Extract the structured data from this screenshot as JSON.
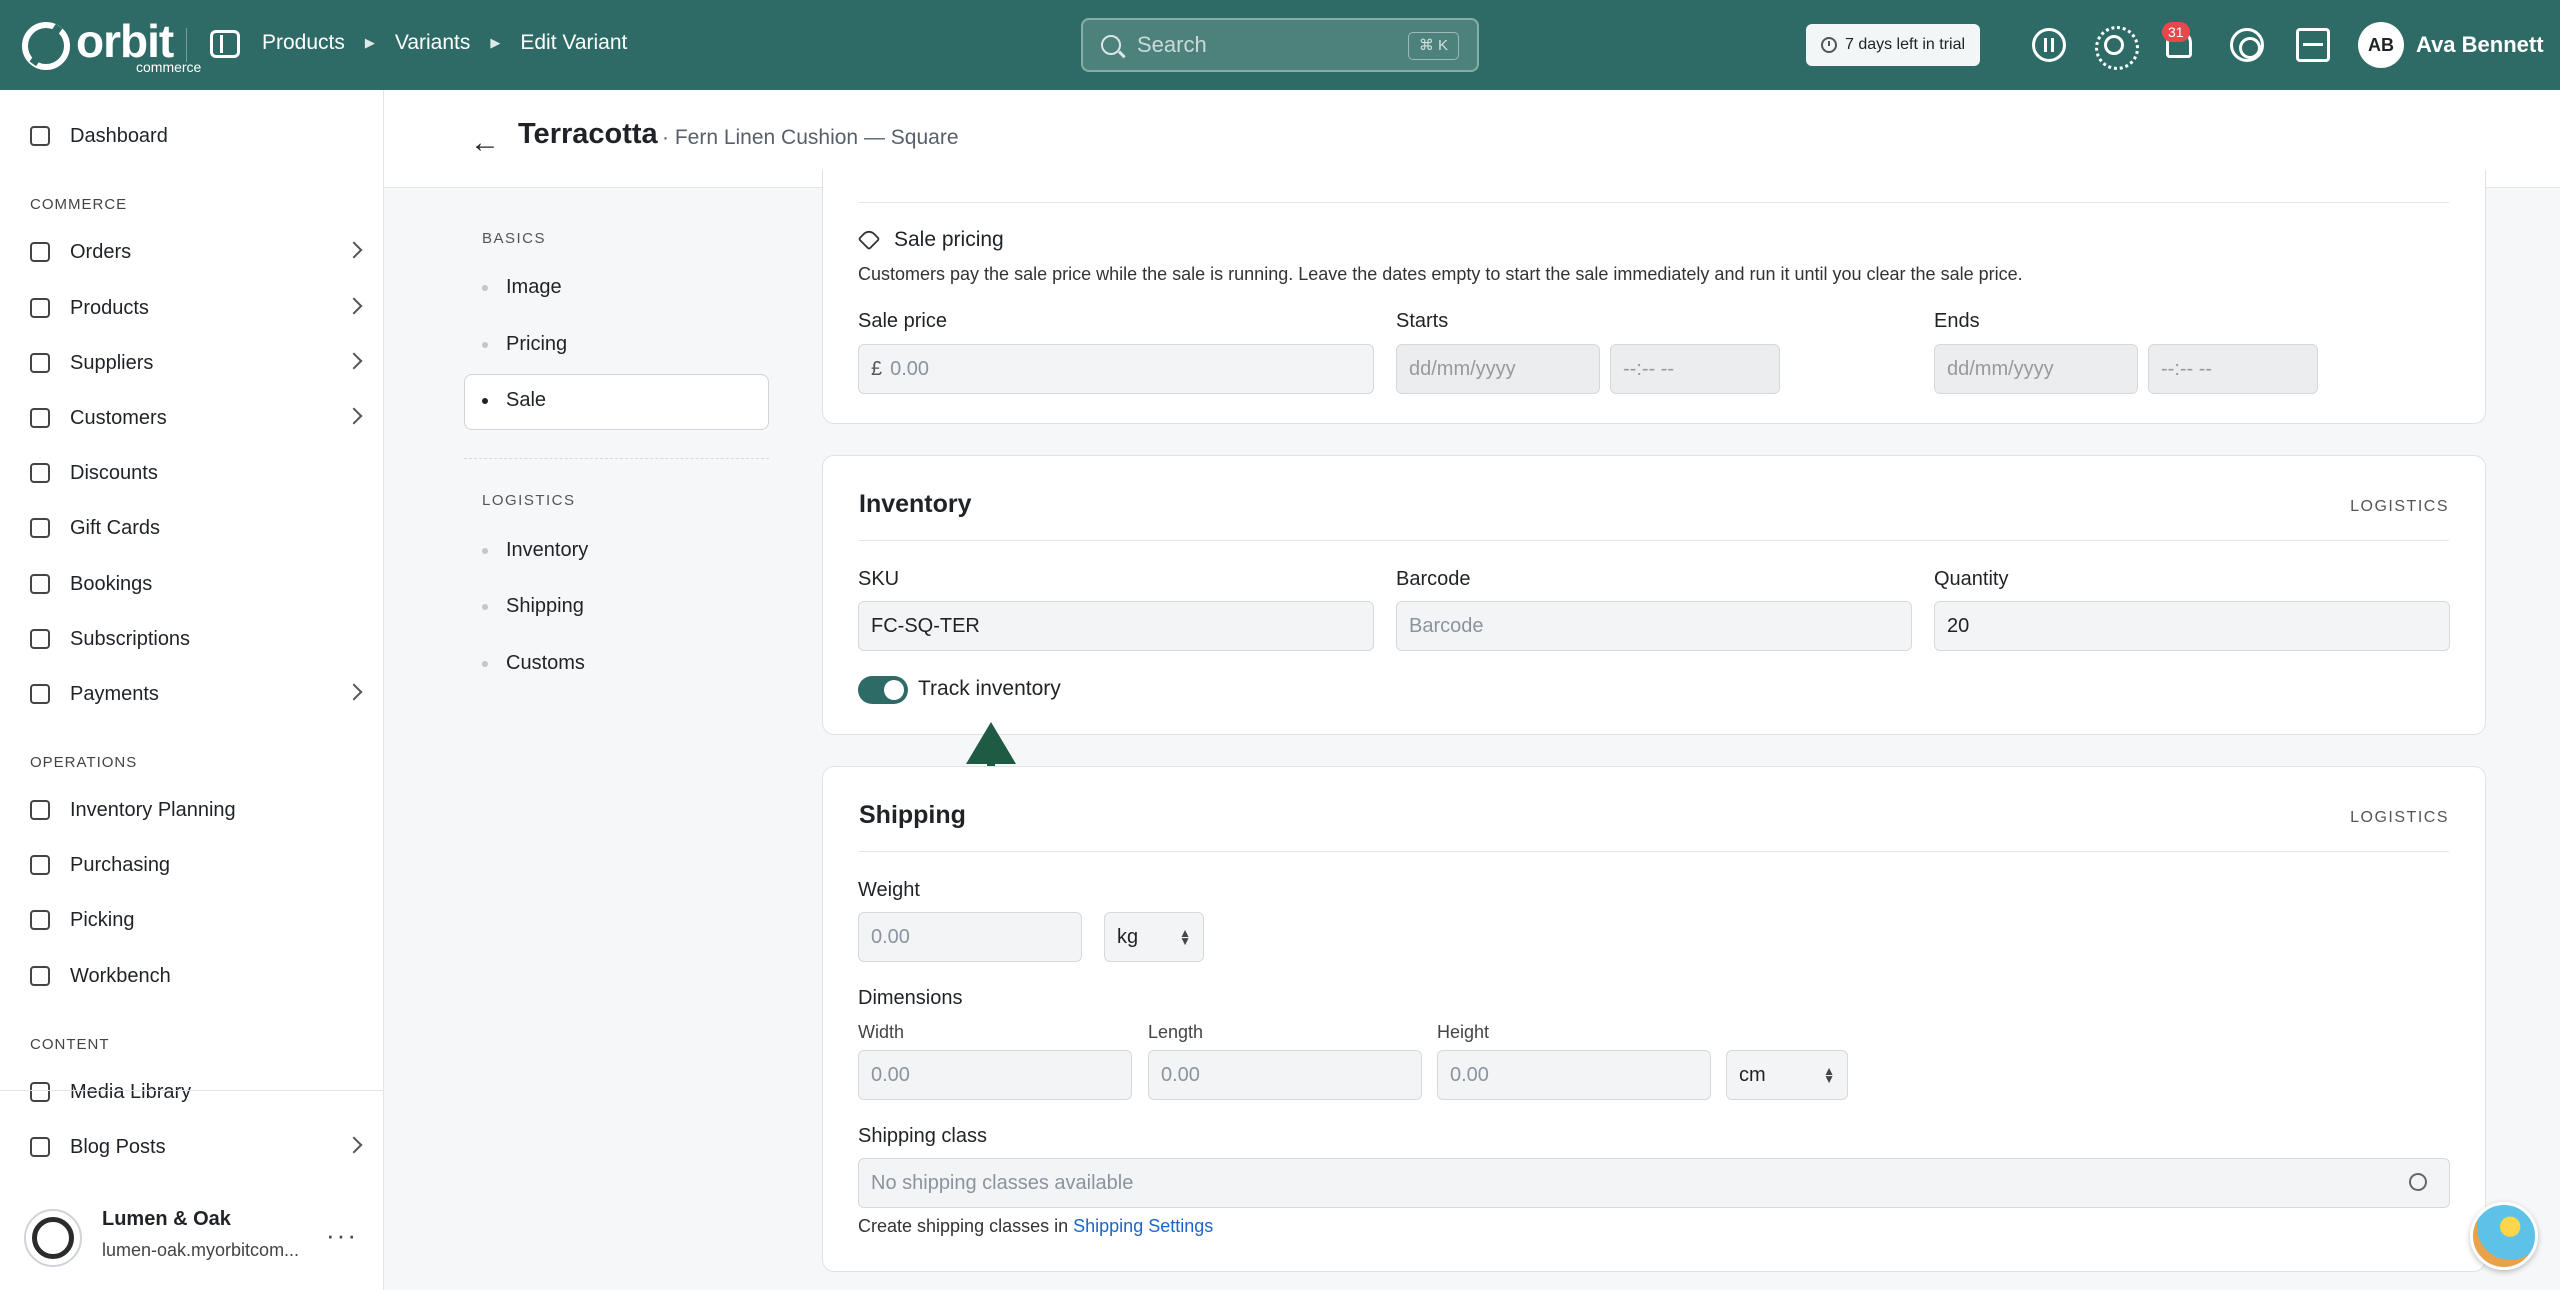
{
  "topbar": {
    "logo_text": "orbit",
    "logo_sub": "commerce",
    "breadcrumbs": [
      "Products",
      "Variants",
      "Edit Variant"
    ],
    "search_placeholder": "Search",
    "search_shortcut": "⌘ K",
    "trial_text": "7 days left in trial",
    "notification_count": "31",
    "user_initials": "AB",
    "user_name": "Ava Bennett",
    "brand_color": "#2e6b66"
  },
  "sidebar": {
    "dashboard": "Dashboard",
    "commerce_label": "COMMERCE",
    "commerce_items": [
      "Orders",
      "Products",
      "Suppliers",
      "Customers",
      "Discounts",
      "Gift Cards",
      "Bookings",
      "Subscriptions",
      "Payments"
    ],
    "operations_label": "OPERATIONS",
    "operations_items": [
      "Inventory Planning",
      "Purchasing",
      "Picking",
      "Workbench"
    ],
    "content_label": "CONTENT",
    "content_items": [
      "Media Library",
      "Blog Posts"
    ],
    "store_name": "Lumen & Oak",
    "store_url": "lumen-oak.myorbitcom...",
    "store_more": "···"
  },
  "header": {
    "back": "←",
    "title": "Terracotta",
    "subtitle": "· Fern Linen Cushion — Square"
  },
  "section_nav": {
    "basics_label": "BASICS",
    "basics_items": [
      "Image",
      "Pricing",
      "Sale"
    ],
    "active": "Sale",
    "logistics_label": "LOGISTICS",
    "logistics_items": [
      "Inventory",
      "Shipping",
      "Customs"
    ]
  },
  "sale": {
    "title": "Sale pricing",
    "description": "Customers pay the sale price while the sale is running. Leave the dates empty to start the sale immediately and run it until you clear the sale price.",
    "price_label": "Sale price",
    "currency": "£",
    "price_placeholder": "0.00",
    "starts_label": "Starts",
    "ends_label": "Ends",
    "date_placeholder": "dd/mm/yyyy",
    "time_placeholder": "--:-- --"
  },
  "inventory": {
    "title": "Inventory",
    "tag": "LOGISTICS",
    "sku_label": "SKU",
    "sku_value": "FC-SQ-TER",
    "barcode_label": "Barcode",
    "barcode_placeholder": "Barcode",
    "quantity_label": "Quantity",
    "quantity_value": "20",
    "track_label": "Track inventory",
    "track_enabled": true
  },
  "shipping": {
    "title": "Shipping",
    "tag": "LOGISTICS",
    "weight_label": "Weight",
    "weight_placeholder": "0.00",
    "weight_unit": "kg",
    "dimensions_label": "Dimensions",
    "width_label": "Width",
    "length_label": "Length",
    "height_label": "Height",
    "dim_placeholder": "0.00",
    "dim_unit": "cm",
    "class_label": "Shipping class",
    "class_placeholder": "No shipping classes available",
    "help_prefix": "Create shipping classes in",
    "help_link": "Shipping Settings"
  }
}
